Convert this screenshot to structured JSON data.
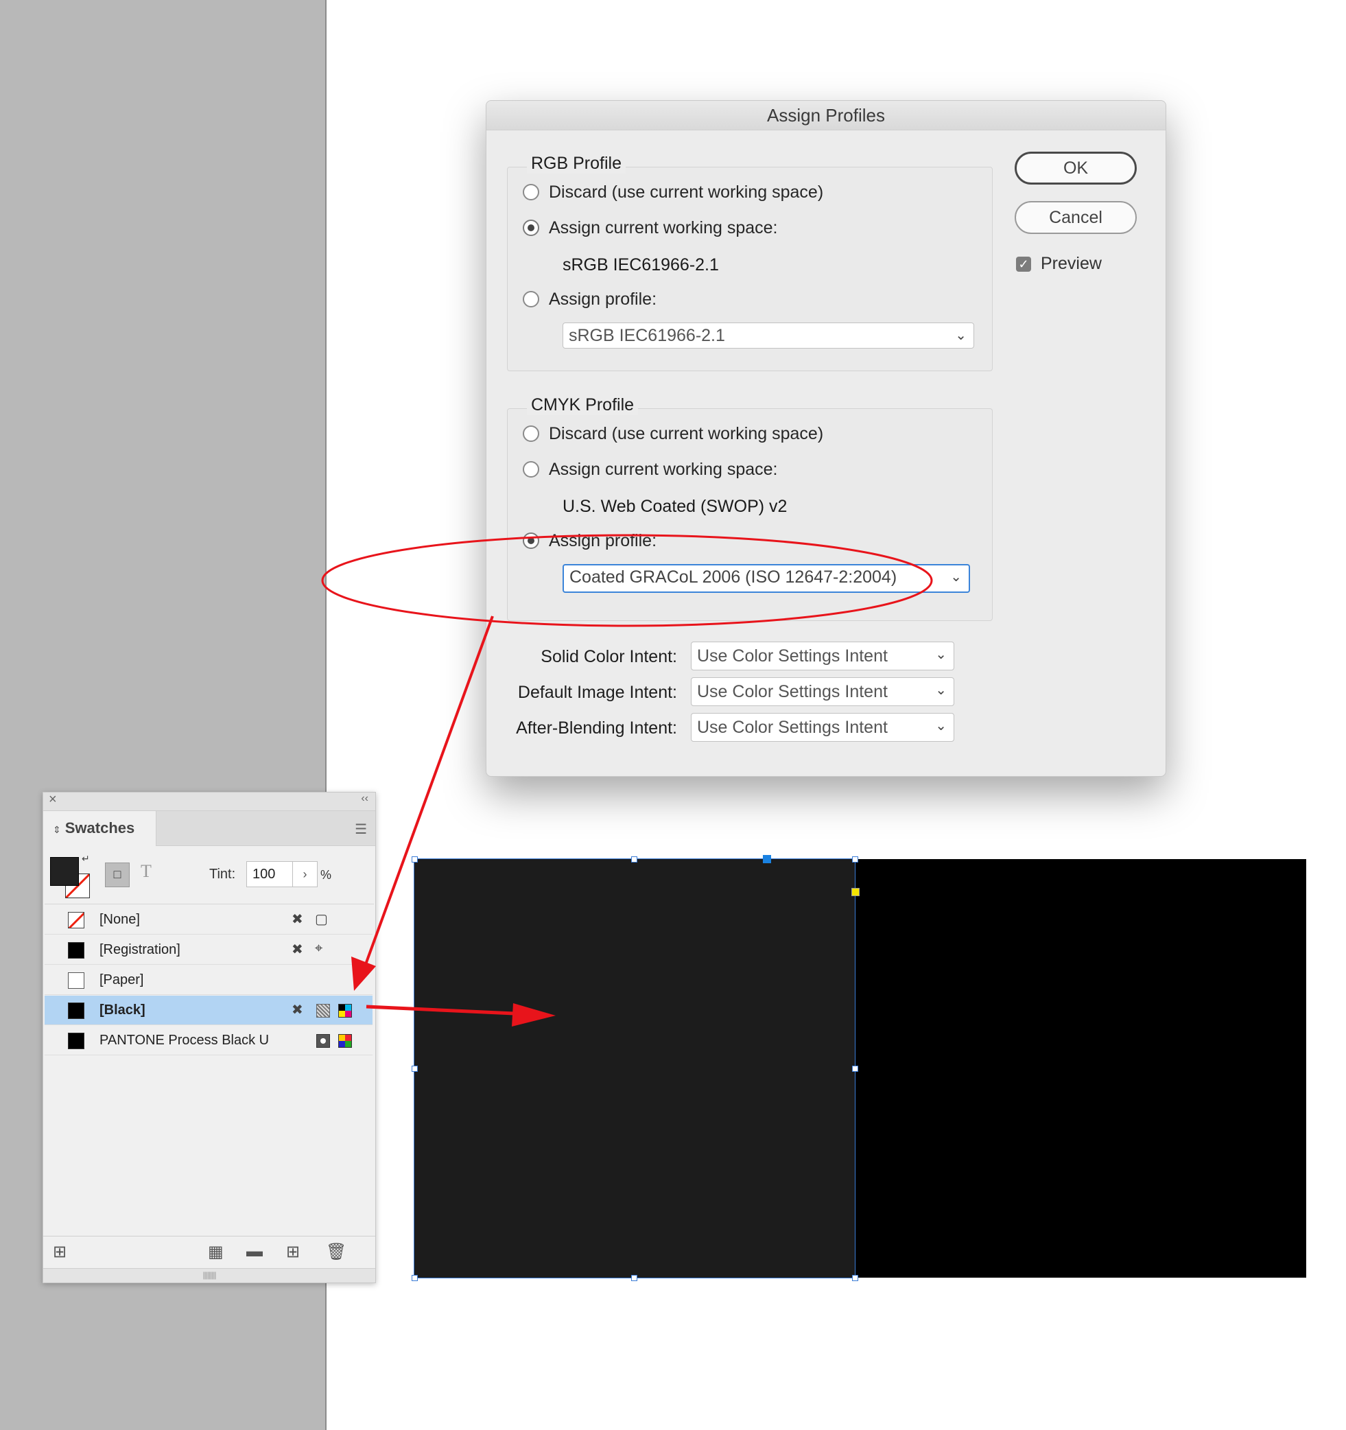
{
  "dialog": {
    "title": "Assign Profiles",
    "ok_label": "OK",
    "cancel_label": "Cancel",
    "preview_label": "Preview",
    "preview_checked": true,
    "rgb": {
      "title": "RGB Profile",
      "discard_label": "Discard (use current working space)",
      "assign_current_label": "Assign current working space:",
      "working_space": "sRGB IEC61966-2.1",
      "assign_profile_label": "Assign profile:",
      "profile_select": "sRGB IEC61966-2.1",
      "selected": "assign_current"
    },
    "cmyk": {
      "title": "CMYK Profile",
      "discard_label": "Discard (use current working space)",
      "assign_current_label": "Assign current working space:",
      "working_space": "U.S. Web Coated (SWOP) v2",
      "assign_profile_label": "Assign profile:",
      "profile_select": "Coated GRACoL 2006 (ISO 12647-2:2004)",
      "selected": "assign_profile"
    },
    "intents": [
      {
        "label": "Solid Color Intent:",
        "value": "Use Color Settings Intent"
      },
      {
        "label": "Default Image Intent:",
        "value": "Use Color Settings Intent"
      },
      {
        "label": "After-Blending Intent:",
        "value": "Use Color Settings Intent"
      }
    ]
  },
  "swatches_panel": {
    "tab_label": "Swatches",
    "tint_label": "Tint:",
    "tint_value": "100",
    "tint_unit": "%",
    "swatches": [
      {
        "name": "[None]",
        "chip": "none"
      },
      {
        "name": "[Registration]",
        "chip": "black"
      },
      {
        "name": "[Paper]",
        "chip": "paper"
      },
      {
        "name": "[Black]",
        "chip": "black",
        "selected": true
      },
      {
        "name": "PANTONE Process Black U",
        "chip": "black"
      }
    ]
  },
  "colors": {
    "annotation_red": "#e8141b",
    "selection_blue": "#b2d4f3",
    "rect_dark": "#1c1c1c",
    "rect_black": "#000000"
  }
}
